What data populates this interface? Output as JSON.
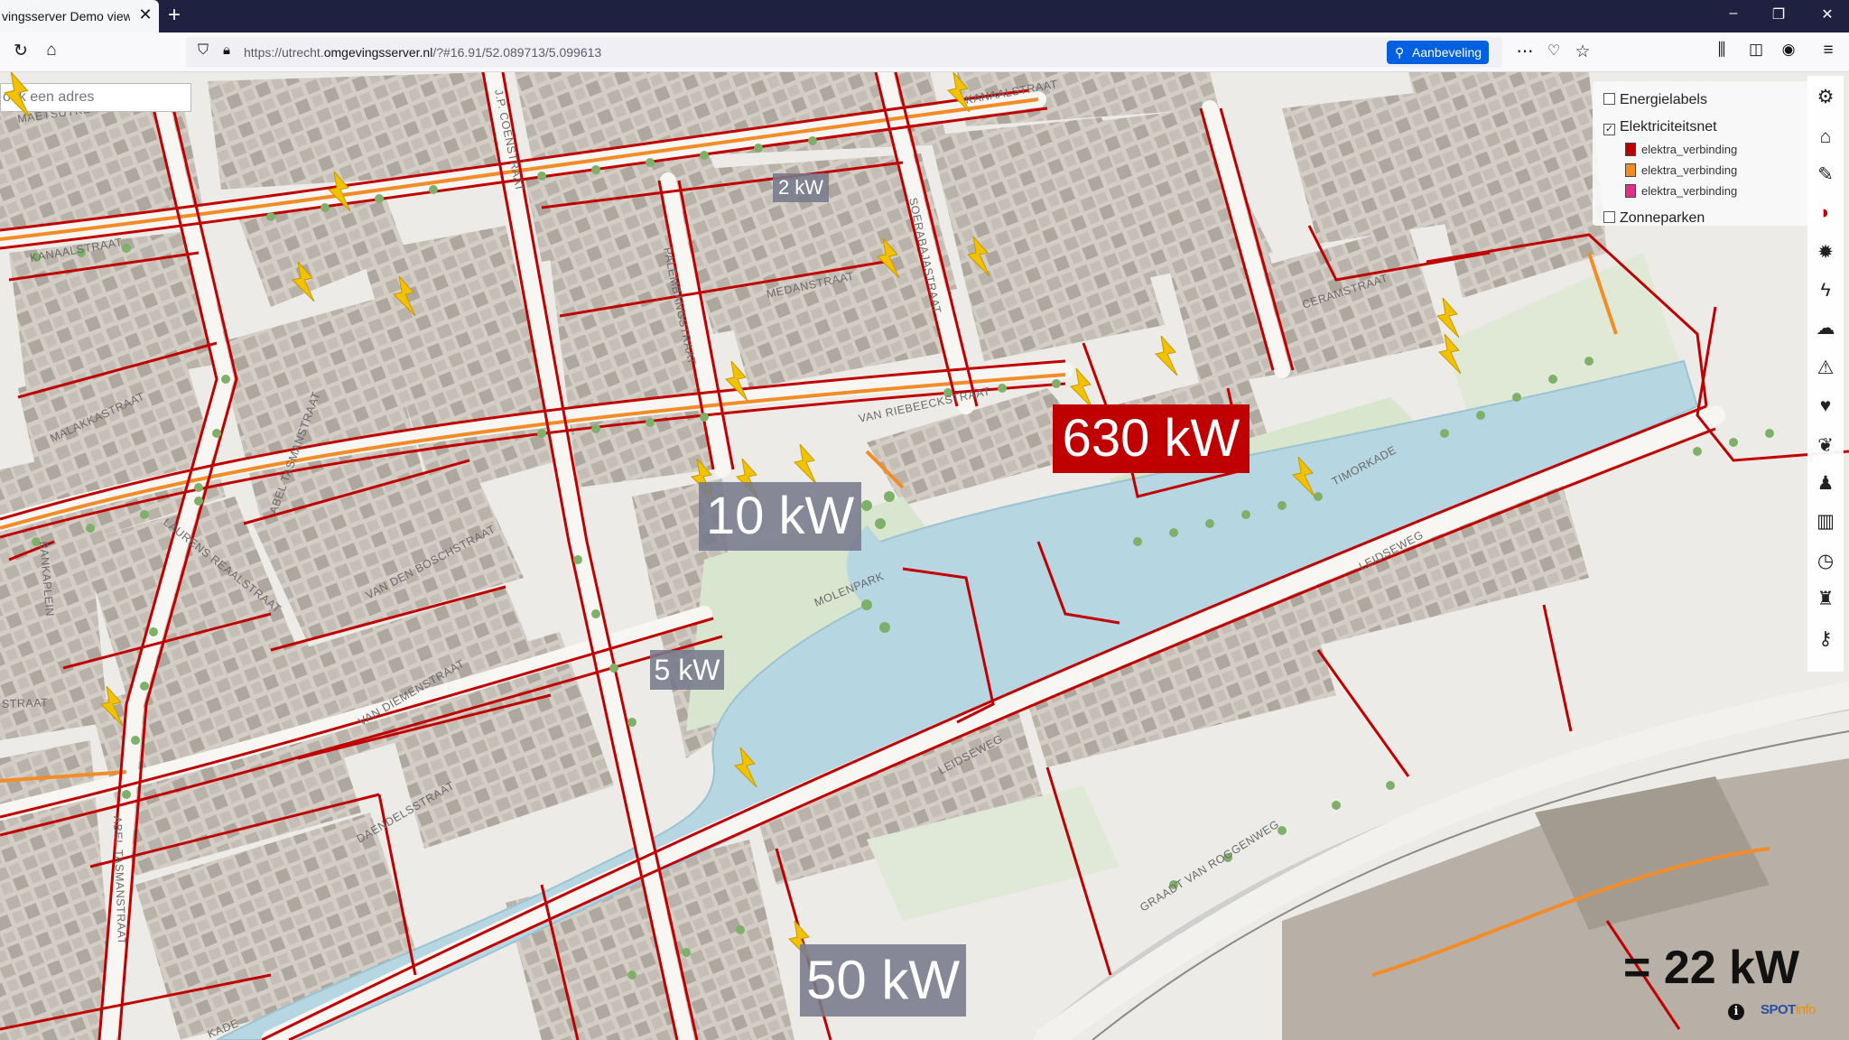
{
  "browser": {
    "tab_title": "vingsserver Demo viewer",
    "tab_close": "✕",
    "new_tab": "+",
    "url_prefix": "https://utrecht.",
    "url_domain": "omgevingsserver.nl",
    "url_path": "/?#16.91/52.089713/5.099613",
    "recommend_label": "Aanbeveling"
  },
  "search": {
    "placeholder": "oek een adres"
  },
  "layers": {
    "items": [
      {
        "label": "Energielabels",
        "checked": false
      },
      {
        "label": "Elektriciteitsnet",
        "checked": true
      },
      {
        "label": "Zonneparken",
        "checked": false
      }
    ],
    "legend": [
      {
        "label": "elektra_verbinding",
        "color": "#c00000"
      },
      {
        "label": "elektra_verbinding",
        "color": "#f28c28"
      },
      {
        "label": "elektra_verbinding",
        "color": "#e0308a"
      }
    ]
  },
  "toolbar": [
    "settings",
    "home",
    "edit",
    "flag",
    "sun",
    "power",
    "cloud",
    "warning",
    "heart",
    "leaf",
    "person",
    "chart",
    "clock",
    "castle",
    "key"
  ],
  "colors": {
    "grid_red": "#c00000",
    "grid_orange": "#f28c28",
    "water": "#b6d6e2",
    "bolt": "#f2c200"
  },
  "labels": {
    "kw630": "630 kW",
    "kw10": "10 kW",
    "kw50": "50 kW",
    "kw5": "5 kW",
    "kw2": "2 kW"
  },
  "legend_text": "= 22 kW",
  "logo": {
    "spot": "SPOT",
    "info": "info"
  },
  "streets": {
    "kanaalstraat": "KANAALSTRAAT",
    "maetsuyker": "MAETSUYKERSTR.",
    "coenstraat": "J.P. COENSTRAAT",
    "medanstraat": "MEDANSTRAAT",
    "soerabaja": "SOERABAJASTRAAT",
    "palembang": "PALEMBANGSTRAAT",
    "riebeeck": "VAN RIEBEECKSTRAAT",
    "ceramstraat": "CERAMSTRAAT",
    "timorkade": "TIMORKADE",
    "malakka": "MALAKKASTRAAT",
    "tasmanstraat": "ABEL TASMANSTRAAT",
    "laurens": "LAURENS REAALSTRAAT",
    "bosch": "VAN DEN BOSCHSTRAAT",
    "bankaplein": "BANKAPLEIN",
    "molenpark": "MOLENPARK",
    "diemen": "VAN DIEMENSTRAAT",
    "daendels": "DAENDELSSTRAAT",
    "leidseweg": "LEIDSEWEG",
    "roggeweg": "GRAADT VAN ROGGENWEG",
    "straat": "STRAAT",
    "kade": "KADE"
  }
}
